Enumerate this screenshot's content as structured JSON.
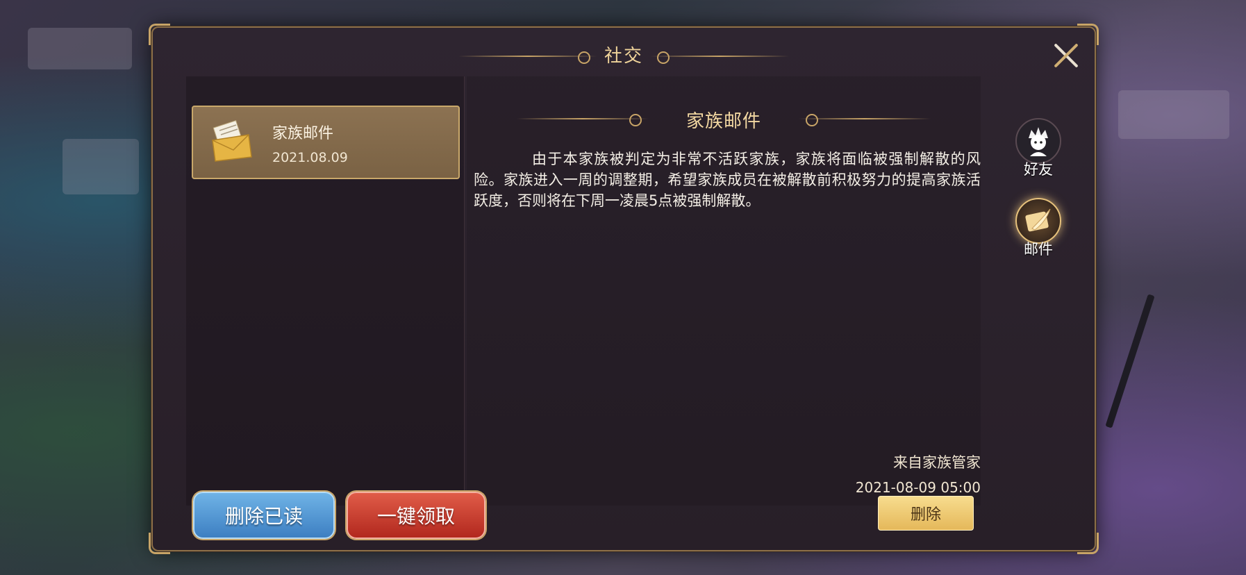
{
  "panel": {
    "title": "社交"
  },
  "mail_list": {
    "items": [
      {
        "title": "家族邮件",
        "date": "2021.08.09",
        "icon": "envelope-icon",
        "selected": true
      }
    ]
  },
  "mail_detail": {
    "title": "家族邮件",
    "body": "由于本家族被判定为非常不活跃家族，家族将面临被强制解散的风险。家族进入一周的调整期，希望家族成员在被解散前积极努力的提高家族活跃度，否则将在下周一凌晨5点被强制解散。",
    "sender": "来自家族管家",
    "timestamp": "2021-08-09  05:00"
  },
  "side_tabs": [
    {
      "label": "好友",
      "icon": "friend-avatar-icon",
      "active": false
    },
    {
      "label": "邮件",
      "icon": "mail-feather-icon",
      "active": true
    }
  ],
  "buttons": {
    "delete_read": "删除已读",
    "claim_all": "一键领取",
    "delete": "删除"
  },
  "colors": {
    "accent_gold": "#c8a467",
    "title_text": "#f0d49a",
    "blue_button": "#3d7fc2",
    "red_button": "#b2281e",
    "gold_button": "#e5b85a"
  }
}
